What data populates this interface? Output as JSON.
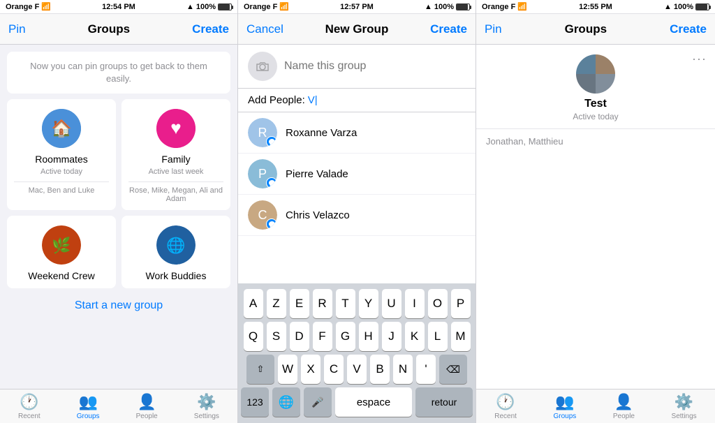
{
  "panels": {
    "left": {
      "statusBar": {
        "carrier": "Orange F",
        "time": "12:54 PM",
        "battery": "100%"
      },
      "navBar": {
        "pin": "Pin",
        "title": "Groups",
        "create": "Create"
      },
      "infoText": "Now you can pin groups to get back to them easily.",
      "groups": [
        {
          "name": "Roommates",
          "status": "Active today",
          "members": "Mac, Ben and Luke",
          "color": "roommates"
        },
        {
          "name": "Family",
          "status": "Active last week",
          "members": "Rose, Mike, Megan, Ali and Adam",
          "color": "family"
        },
        {
          "name": "Weekend Crew",
          "status": "",
          "members": "",
          "color": "weekend"
        },
        {
          "name": "Work Buddies",
          "status": "",
          "members": "",
          "color": "work"
        }
      ],
      "startNewGroup": "Start a new group",
      "tabs": [
        {
          "label": "Recent",
          "icon": "clock"
        },
        {
          "label": "Groups",
          "icon": "groups",
          "active": true
        },
        {
          "label": "People",
          "icon": "people"
        },
        {
          "label": "Settings",
          "icon": "settings"
        }
      ]
    },
    "middle": {
      "statusBar": {
        "carrier": "Orange F",
        "time": "12:57 PM",
        "battery": "100%"
      },
      "navBar": {
        "cancel": "Cancel",
        "title": "New Group",
        "create": "Create"
      },
      "namePlaceholder": "Name this group",
      "addPeopleLabel": "Add People:",
      "searchValue": "V|",
      "results": [
        {
          "name": "Roxanne Varza",
          "hasBadge": true
        },
        {
          "name": "Pierre Valade",
          "hasBadge": true
        },
        {
          "name": "Chris Velazco",
          "hasBadge": true
        }
      ],
      "keyboard": {
        "rows": [
          [
            "A",
            "Z",
            "E",
            "R",
            "T",
            "Y",
            "U",
            "I",
            "O",
            "P"
          ],
          [
            "Q",
            "S",
            "D",
            "F",
            "G",
            "H",
            "J",
            "K",
            "L",
            "M"
          ],
          [
            "W",
            "X",
            "C",
            "V",
            "B",
            "N"
          ]
        ],
        "special": {
          "shift": "⇧",
          "delete": "⌫",
          "num": "123",
          "globe": "🌐",
          "mic": "🎤",
          "space": "espace",
          "return": "retour"
        }
      }
    },
    "right": {
      "statusBar": {
        "carrier": "Orange F",
        "time": "12:55 PM",
        "battery": "100%"
      },
      "navBar": {
        "pin": "Pin",
        "title": "Groups",
        "create": "Create"
      },
      "group": {
        "name": "Test",
        "status": "Active today",
        "members": "Jonathan, Matthieu"
      },
      "tabs": [
        {
          "label": "Recent",
          "icon": "clock"
        },
        {
          "label": "Groups",
          "icon": "groups",
          "active": true
        },
        {
          "label": "People",
          "icon": "people"
        },
        {
          "label": "Settings",
          "icon": "settings"
        }
      ]
    }
  }
}
